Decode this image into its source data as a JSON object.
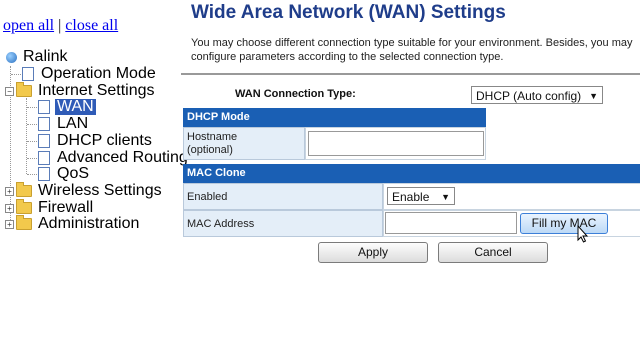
{
  "sidebar": {
    "open_all": "open all",
    "separator": "|",
    "close_all": "close all",
    "tree": {
      "root": "Ralink",
      "operation_mode": "Operation Mode",
      "internet_settings": "Internet Settings",
      "wan": "WAN",
      "lan": "LAN",
      "dhcp_clients": "DHCP clients",
      "advanced_routing": "Advanced Routing",
      "qos": "QoS",
      "wireless_settings": "Wireless Settings",
      "firewall": "Firewall",
      "administration": "Administration"
    }
  },
  "main": {
    "title": "Wide Area Network (WAN) Settings",
    "description": "You may choose different connection type suitable for your environment. Besides, you may configure parameters according to the selected connection type.",
    "connection_type_label": "WAN Connection Type:",
    "connection_type_value": "DHCP (Auto config)",
    "dhcp_section": "DHCP Mode",
    "hostname_label_line1": "Hostname",
    "hostname_label_line2": "(optional)",
    "hostname_value": "",
    "mac_clone_section": "MAC Clone",
    "enabled_label": "Enabled",
    "enabled_value": "Enable",
    "mac_address_label": "MAC Address",
    "mac_address_value": "",
    "fill_mac_button": "Fill my MAC",
    "apply_button": "Apply",
    "cancel_button": "Cancel"
  },
  "colors": {
    "title": "#1f3d8a",
    "section_header": "#1a5fb4",
    "label_cell": "#e4eef8",
    "selected_node": "#2f5bb7"
  }
}
